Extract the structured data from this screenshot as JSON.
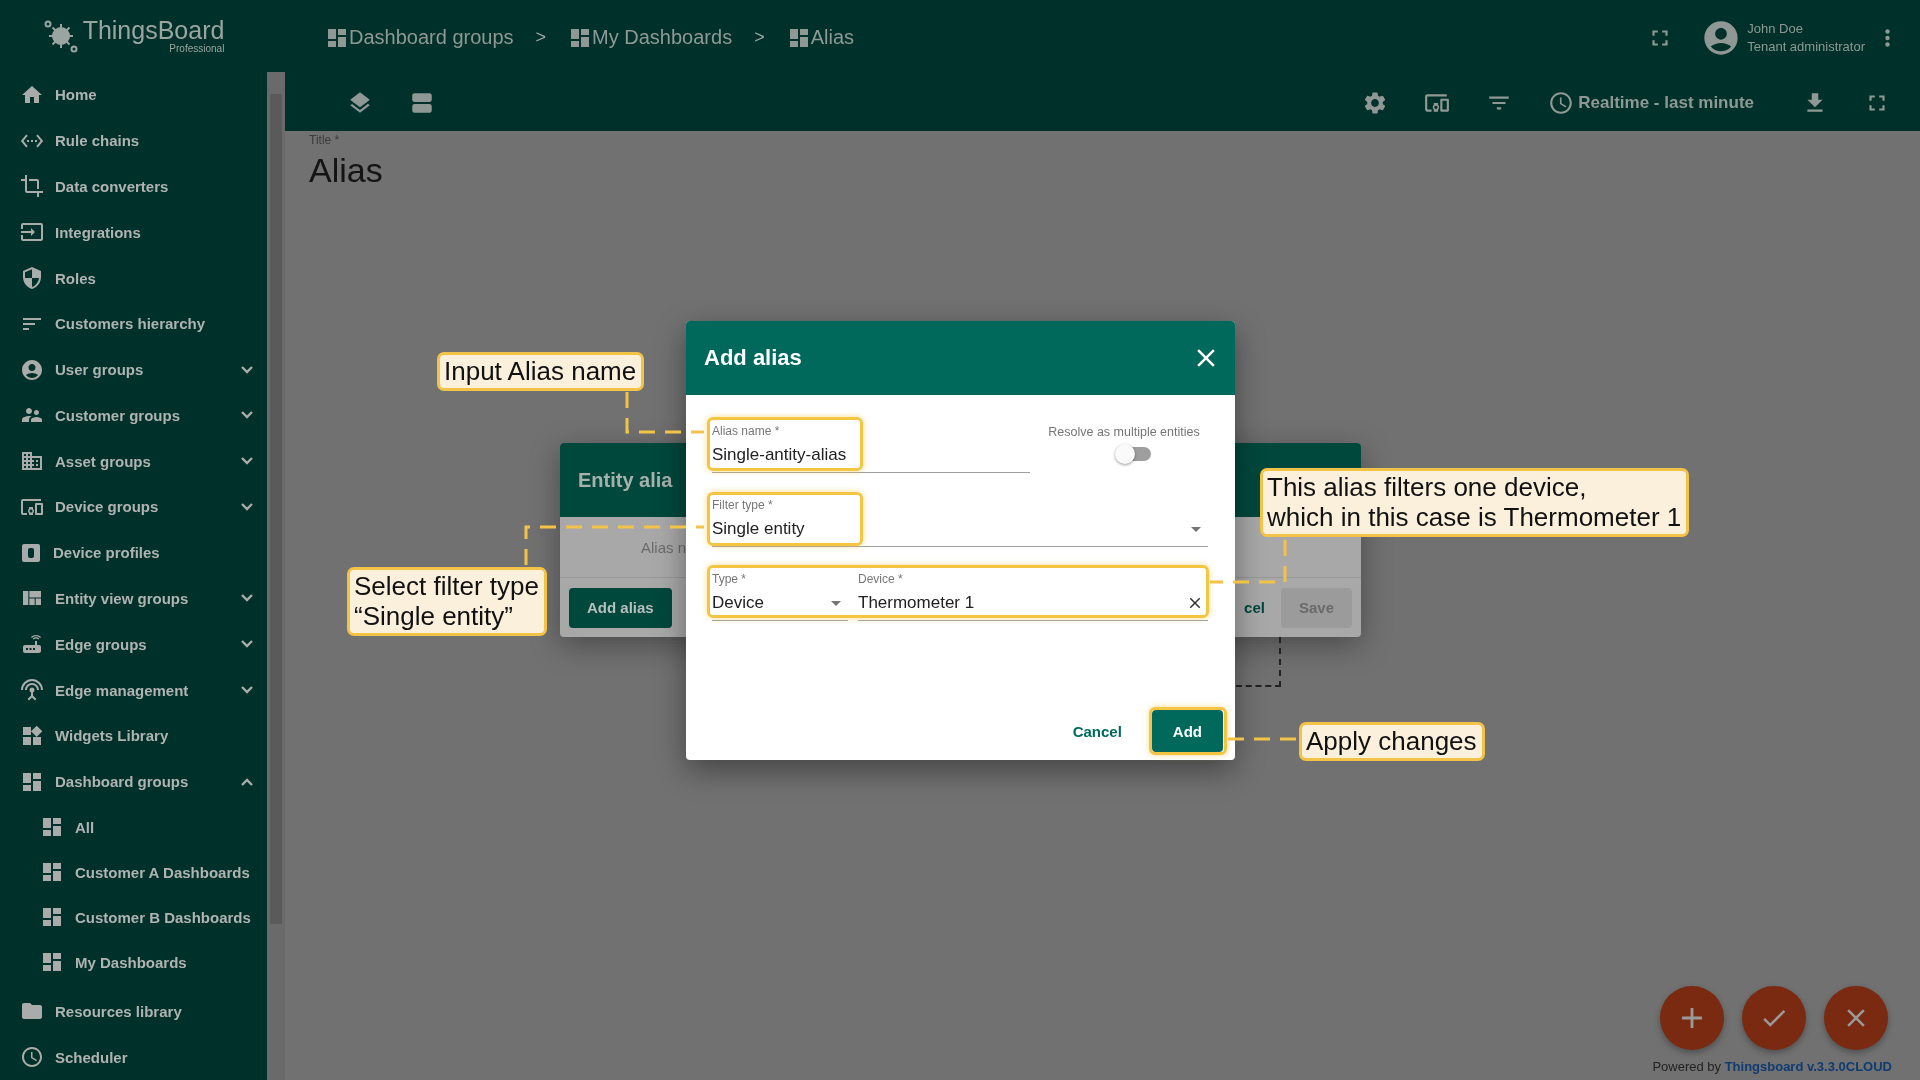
{
  "logo": {
    "name": "ThingsBoard",
    "edition": "Professional"
  },
  "sidebar": {
    "items": [
      {
        "label": "Home"
      },
      {
        "label": "Rule chains"
      },
      {
        "label": "Data converters"
      },
      {
        "label": "Integrations"
      },
      {
        "label": "Roles"
      },
      {
        "label": "Customers hierarchy"
      },
      {
        "label": "User groups",
        "expanded": false
      },
      {
        "label": "Customer groups",
        "expanded": false
      },
      {
        "label": "Asset groups",
        "expanded": false
      },
      {
        "label": "Device groups",
        "expanded": false
      },
      {
        "label": "Device profiles"
      },
      {
        "label": "Entity view groups",
        "expanded": false
      },
      {
        "label": "Edge groups",
        "expanded": false
      },
      {
        "label": "Edge management",
        "expanded": false
      },
      {
        "label": "Widgets Library"
      },
      {
        "label": "Dashboard groups",
        "expanded": true,
        "children": [
          {
            "label": "All"
          },
          {
            "label": "Customer A Dashboards"
          },
          {
            "label": "Customer B Dashboards"
          },
          {
            "label": "My Dashboards"
          }
        ]
      },
      {
        "label": "Resources library"
      },
      {
        "label": "Scheduler"
      }
    ]
  },
  "breadcrumbs": [
    {
      "label": "Dashboard groups"
    },
    {
      "separator": ">",
      "label": "My Dashboards"
    },
    {
      "separator": ">",
      "label": "Alias"
    }
  ],
  "user": {
    "name": "John Doe",
    "role": "Tenant administrator"
  },
  "toolbar": {
    "timewindow": "Realtime - last minute"
  },
  "dashboard": {
    "title_label": "Title *",
    "title": "Alias"
  },
  "entity_aliases_dialog": {
    "title": "Entity alia",
    "column_header": "Alias n",
    "buttons": [
      {
        "label": "Add alias",
        "kind": "primary"
      },
      {
        "label": "cel",
        "kind": "text"
      },
      {
        "label": "Save",
        "kind": "disabled"
      }
    ]
  },
  "add_alias_dialog": {
    "title": "Add alias",
    "alias_name": {
      "label": "Alias name *",
      "value": "Single-antity-alias"
    },
    "resolve_multiple": {
      "label": "Resolve as multiple entities",
      "on": false
    },
    "filter_type": {
      "label": "Filter type *",
      "value": "Single entity"
    },
    "entity_type": {
      "label": "Type *",
      "value": "Device"
    },
    "device": {
      "label": "Device *",
      "value": "Thermometer 1"
    },
    "buttons": [
      {
        "label": "Cancel",
        "kind": "text"
      },
      {
        "label": "Add",
        "kind": "primary"
      }
    ]
  },
  "annotations": [
    {
      "lines": [
        "Input Alias name"
      ]
    },
    {
      "lines": [
        "Select filter type",
        "“Single entity”"
      ]
    },
    {
      "lines": [
        "This alias filters one device,",
        "which in this case is Thermometer 1"
      ]
    },
    {
      "lines": [
        "Apply changes"
      ]
    }
  ],
  "footer": {
    "prefix": "Powered by",
    "link": "Thingsboard v.3.3.0CLOUD"
  }
}
